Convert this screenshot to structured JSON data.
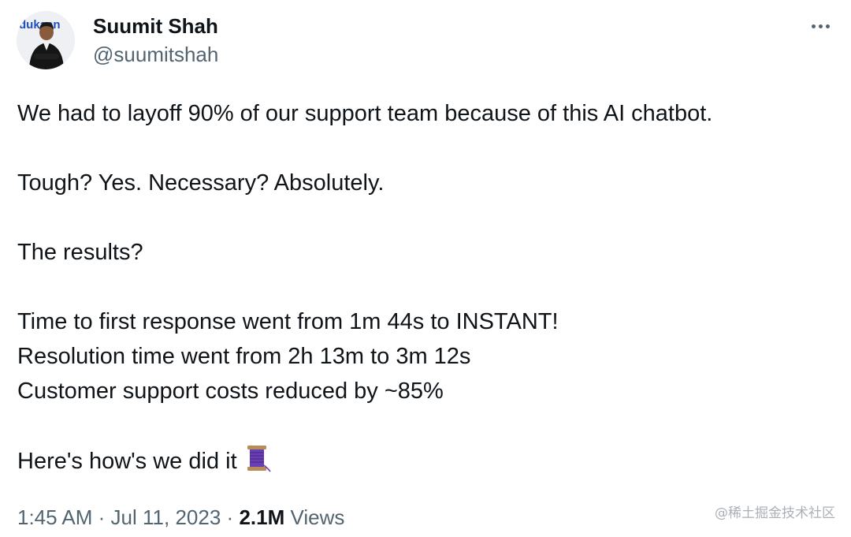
{
  "author": {
    "display_name": "Suumit Shah",
    "handle": "@suumitshah",
    "avatar_logo_text": "dukaan"
  },
  "tweet": {
    "paragraphs": [
      [
        "We had to layoff 90% of our support team because of this AI chatbot."
      ],
      [
        "Tough? Yes. Necessary? Absolutely."
      ],
      [
        "The results?"
      ],
      [
        "Time to first response went from 1m 44s to INSTANT!",
        "Resolution time went from 2h 13m to 3m 12s",
        "Customer support costs reduced by ~85%"
      ],
      [
        "Here's how's we did it"
      ]
    ],
    "emoji": "thread-spool-icon"
  },
  "meta": {
    "time": "1:45 AM",
    "separator": "·",
    "date": "Jul 11, 2023",
    "views_count": "2.1M",
    "views_label": "Views"
  },
  "watermark": "@稀土掘金技术社区",
  "colors": {
    "text": "#0f1419",
    "secondary": "#536471",
    "spool_thread": "#6a3fb5",
    "spool_wood": "#b98a5a"
  }
}
